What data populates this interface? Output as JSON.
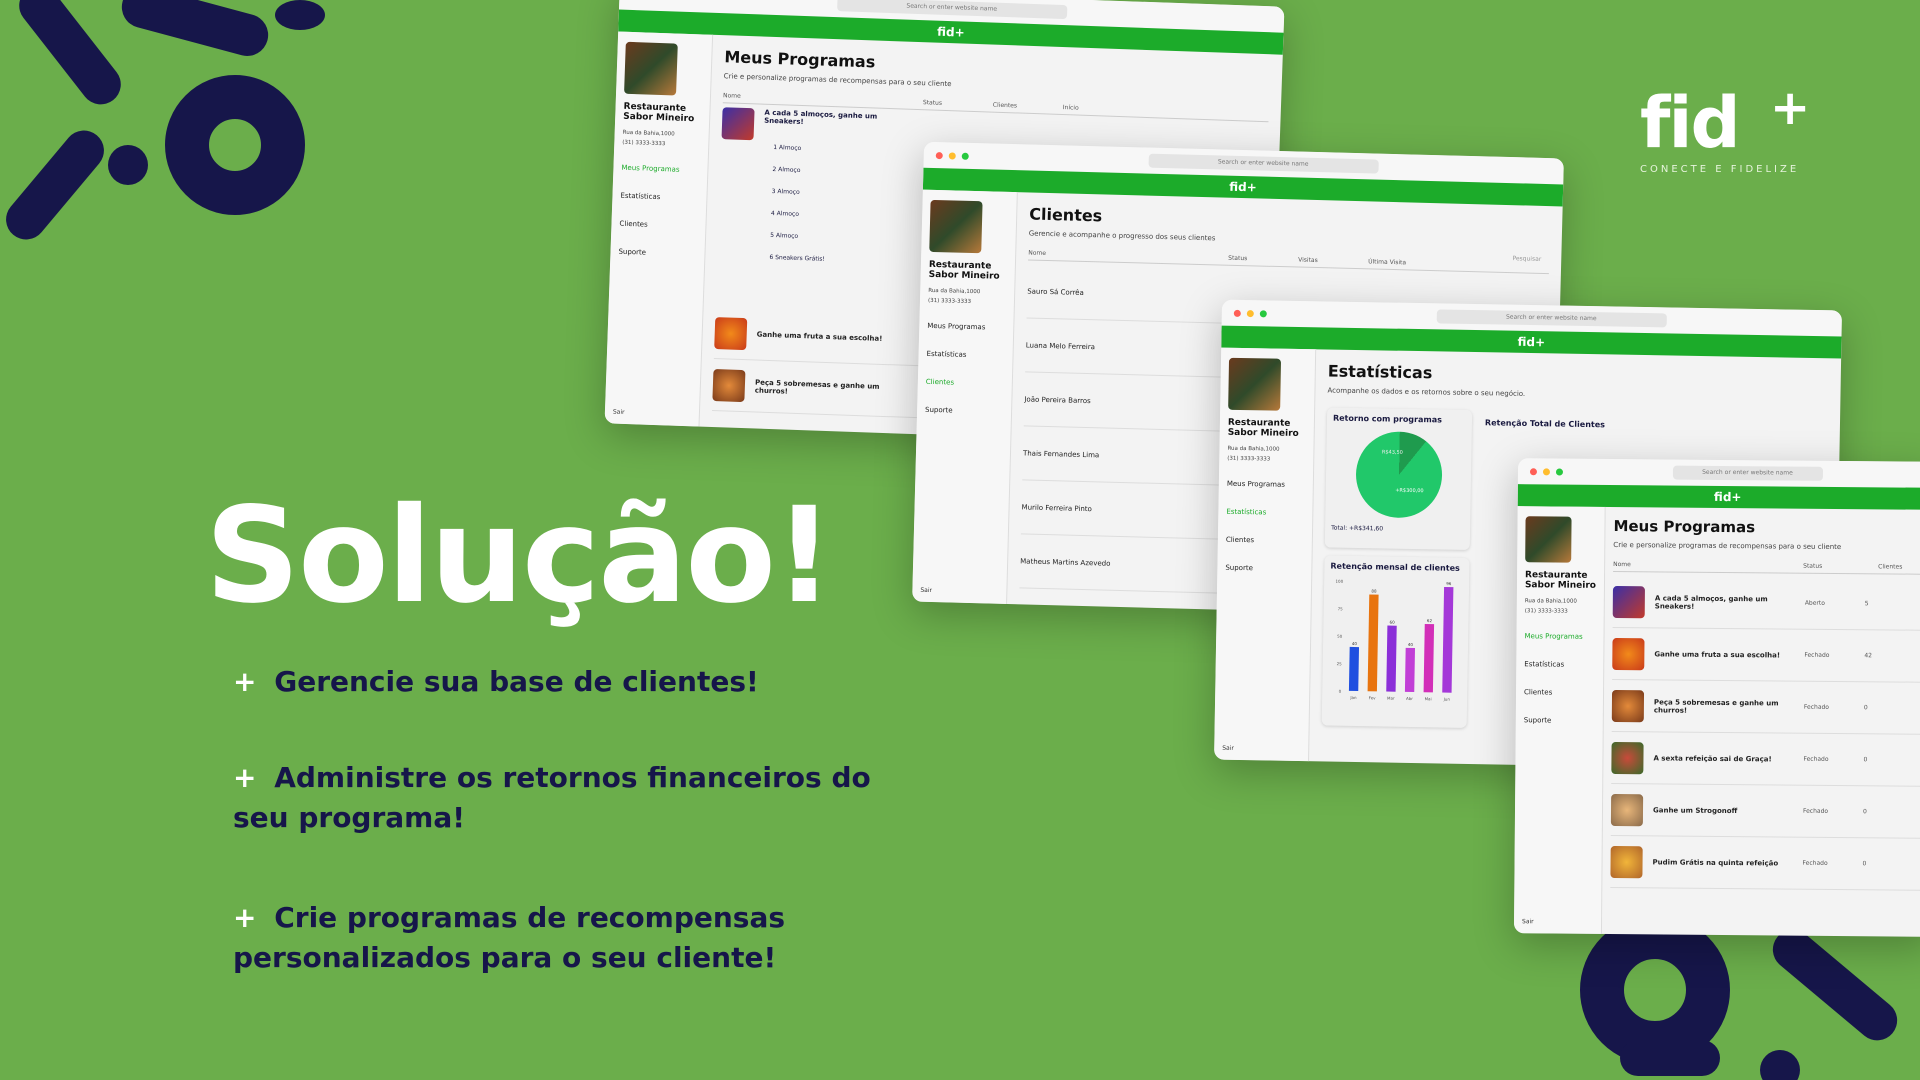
{
  "hero": {
    "title": "Solução!",
    "bullets": [
      {
        "plus": "+",
        "text": "Gerencie sua base de clientes!"
      },
      {
        "plus": "+",
        "text": "Administre os retornos financeiros do seu programa!"
      },
      {
        "plus": "+",
        "text": "Crie programas de recompensas personalizados para o seu cliente!"
      }
    ]
  },
  "logo": {
    "name": "fid",
    "plus": "+",
    "tagline": "CONECTE E FIDELIZE"
  },
  "colors": {
    "background": "#6bae4b",
    "navy": "#16164a",
    "green_bar": "#1cab2a"
  },
  "windows": {
    "address_placeholder": "Search or enter website name",
    "brand": "fid+",
    "restaurant": {
      "name": "Restaurante Sabor Mineiro",
      "address": "Rua da Bahia,1000",
      "phone": "(31) 3333-3333"
    },
    "nav": [
      "Meus Programas",
      "Estatísticas",
      "Clientes",
      "Suporte"
    ],
    "exit": "Sair",
    "programs": {
      "title": "Meus Programas",
      "subtitle": "Crie e personalize programas de recompensas para o seu cliente",
      "columns": [
        "Nome",
        "Status",
        "Clientes",
        "Início"
      ],
      "steps": [
        "1 Almoço",
        "2 Almoço",
        "3 Almoço",
        "4 Almoço",
        "5 Almoço",
        "6 Sneakers Grátis!"
      ],
      "rows": [
        {
          "name": "A cada 5 almoços, ganhe um Sneakers!",
          "status": "Aberto",
          "clients": "5"
        },
        {
          "name": "Ganhe uma fruta a sua escolha!",
          "status": "Fechado",
          "clients": "42"
        },
        {
          "name": "Peça 5 sobremesas e ganhe um churros!",
          "status": "Fechado",
          "clients": "0"
        },
        {
          "name": "A sexta refeição sai de Graça!",
          "status": "Fechado",
          "clients": "0"
        },
        {
          "name": "Ganhe um Strogonoff",
          "status": "Fechado",
          "clients": "0"
        },
        {
          "name": "Pudim Grátis na quinta refeição",
          "status": "Fechado",
          "clients": "0"
        }
      ]
    },
    "clients": {
      "title": "Clientes",
      "subtitle": "Gerencie e acompanhe o progresso dos seus clientes",
      "search": "Pesquisar",
      "columns": [
        "Nome",
        "Status",
        "Visitas",
        "Última Visita"
      ],
      "names": [
        "Sauro Sá Corrêa",
        "Luana Melo Ferreira",
        "João Pereira Barros",
        "Thais Fernandes Lima",
        "Murilo Ferreira Pinto",
        "Matheus Martins Azevedo"
      ]
    },
    "stats": {
      "title": "Estatísticas",
      "subtitle": "Acompanhe os dados e os retornos sobre o seu negócio.",
      "return_title": "Retorno com programas",
      "pie_labels": [
        "R$43,50",
        "+R$300,00"
      ],
      "total": "Total: +R$341,60",
      "retention_total": "Retenção Total de Clientes",
      "retention_monthly": "Retenção mensal de clientes"
    }
  },
  "chart_data": {
    "type": "bar",
    "title": "Retenção mensal de clientes",
    "categories": [
      "Jan",
      "Fev",
      "Mar",
      "Abr",
      "Mai",
      "Jun"
    ],
    "values": [
      40,
      88,
      60,
      40,
      62,
      96
    ],
    "ylim": [
      0,
      100
    ],
    "yticks": [
      0,
      25,
      50,
      75,
      100
    ],
    "colors": [
      "#1f4fe0",
      "#e8740f",
      "#8b2fd8",
      "#c13fd6",
      "#d22fb8",
      "#a438d8"
    ]
  }
}
